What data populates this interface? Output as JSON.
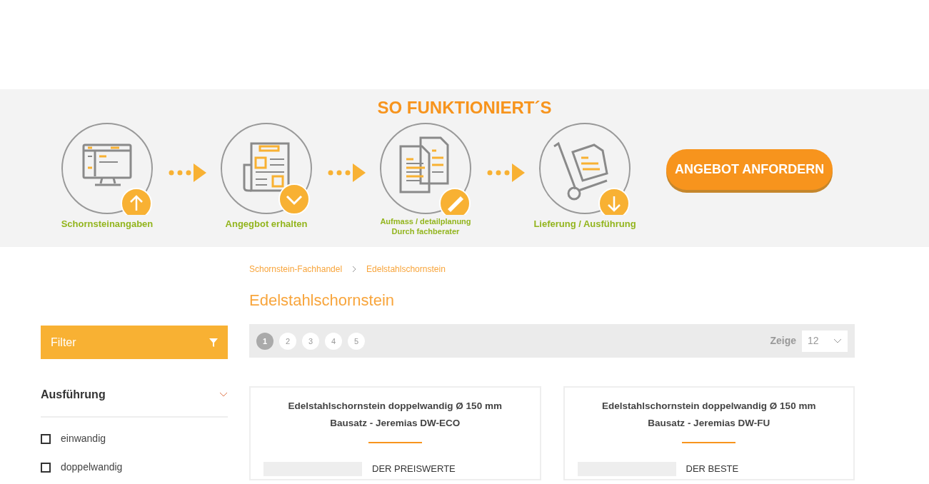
{
  "how_it_works": {
    "title": "SO FUNKTIONIERT´S",
    "steps": [
      {
        "kind": "monitor",
        "badge": {
          "kind": "up"
        },
        "label": "Schornsteinangaben"
      },
      {
        "kind": "newspaper",
        "badge": {
          "kind": "down-chevron"
        },
        "label": "Angegbot erhalten"
      },
      {
        "kind": "documents",
        "badge": {
          "kind": "ruler"
        },
        "label": "Aufmass / detailplanung\nDurch fachberater"
      },
      {
        "kind": "trolley",
        "badge": {
          "kind": "down"
        },
        "label": "Lieferung / Ausführung"
      }
    ],
    "cta": "ANGEBOT ANFORDERN"
  },
  "breadcrumb": [
    "Schornstein-Fachhandel",
    "Edelstahlschornstein"
  ],
  "page_title": "Edelstahlschornstein",
  "sidebar": {
    "filter_label": "Filter",
    "section": {
      "title": "Ausführung",
      "expanded": false,
      "options": [
        {
          "label": "einwandig",
          "checked": false
        },
        {
          "label": "doppelwandig",
          "checked": false
        }
      ]
    }
  },
  "toolbar": {
    "pages": [
      {
        "label": "1",
        "selected": true
      },
      {
        "label": "2",
        "selected": false
      },
      {
        "label": "3",
        "selected": false
      },
      {
        "label": "4",
        "selected": false
      },
      {
        "label": "5",
        "selected": false
      }
    ],
    "show_label": "Zeige",
    "show_value": "12"
  },
  "products": [
    {
      "title": "Edelstahlschornstein doppelwandig Ø 150 mm\nBausatz - Jeremias DW-ECO",
      "tagline": "DER PREISWERTE"
    },
    {
      "title": "Edelstahlschornstein doppelwandig Ø 150 mm\nBausatz - Jeremias DW-FU",
      "tagline": "DER BESTE"
    }
  ]
}
